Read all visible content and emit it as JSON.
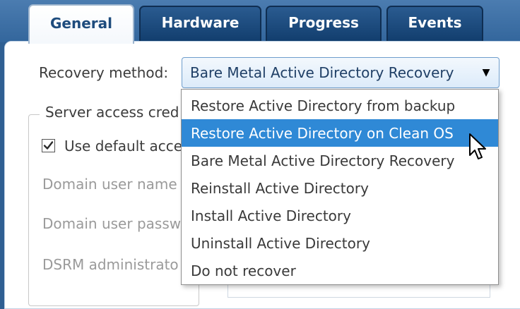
{
  "tabs": [
    {
      "label": "General",
      "active": true
    },
    {
      "label": "Hardware",
      "active": false
    },
    {
      "label": "Progress",
      "active": false
    },
    {
      "label": "Events",
      "active": false
    }
  ],
  "recovery": {
    "label": "Recovery method:",
    "selected": "Bare Metal Active Directory Recovery",
    "options": [
      "Restore Active Directory from backup",
      "Restore Active Directory on Clean OS",
      "Bare Metal Active Directory Recovery",
      "Reinstall Active Directory",
      "Install Active Directory",
      "Uninstall Active Directory",
      "Do not recover"
    ],
    "highlighted": "Restore Active Directory on Clean OS"
  },
  "credentials": {
    "group_label": "Server access cred",
    "use_default_label": "Use default acce",
    "use_default_checked": true,
    "domain_user_name_label": "Domain user name",
    "domain_user_password_label": "Domain user passw",
    "dsrm_label": "DSRM administrato"
  },
  "colors": {
    "tab_bg": "#1a4a7c",
    "highlight": "#2f89d6",
    "combo_border": "#6e9dcc"
  }
}
